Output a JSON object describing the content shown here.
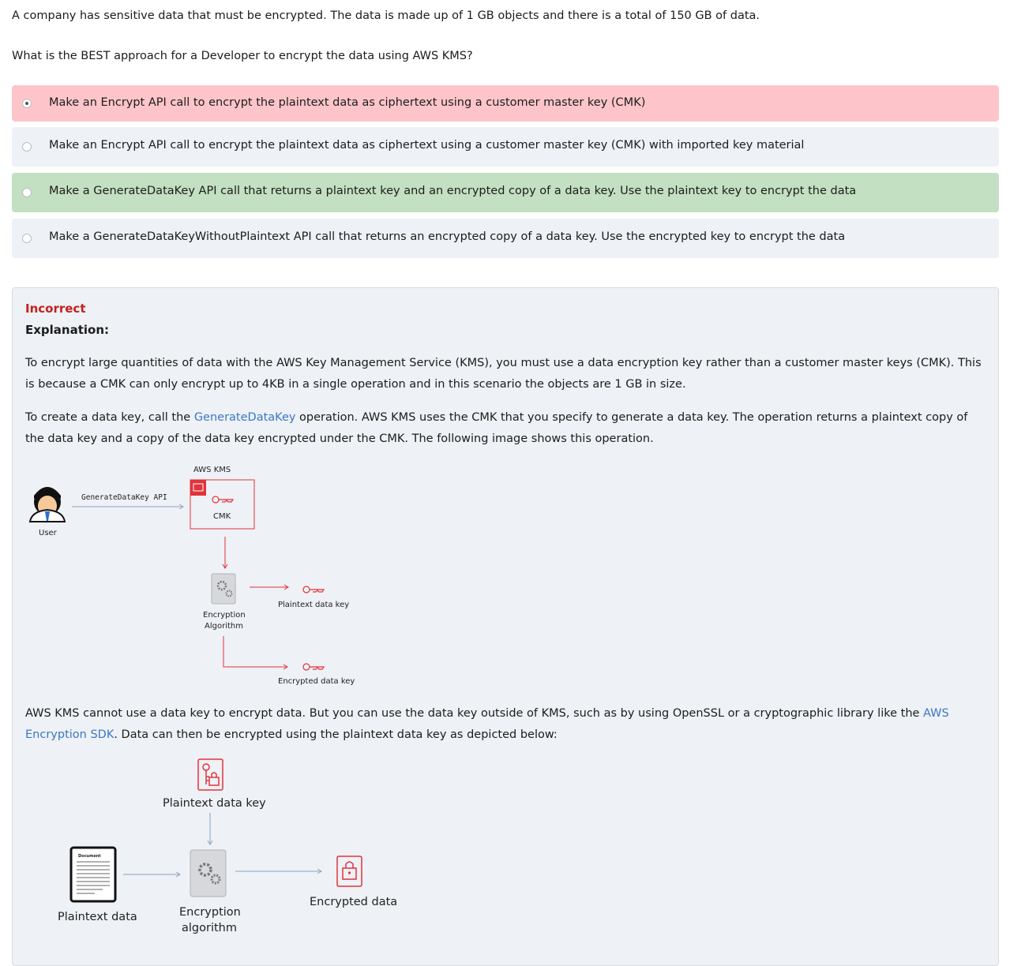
{
  "question": {
    "line1": "A company has sensitive data that must be encrypted. The data is made up of 1 GB objects and there is a total of 150 GB of data.",
    "line2": "What is the BEST approach for a Developer to encrypt the data using AWS KMS?"
  },
  "options": [
    {
      "label": "Make an Encrypt API call to encrypt the plaintext data as ciphertext using a customer master key (CMK)",
      "state": "selected-incorrect"
    },
    {
      "label": "Make an Encrypt API call to encrypt the plaintext data as ciphertext using a customer master key (CMK) with imported key material",
      "state": "none"
    },
    {
      "label": "Make a GenerateDataKey API call that returns a plaintext key and an encrypted copy of a data key. Use the plaintext key to encrypt the data",
      "state": "correct"
    },
    {
      "label": "Make a GenerateDataKeyWithoutPlaintext API call that returns an encrypted copy of a data key. Use the encrypted key to encrypt the data",
      "state": "none"
    }
  ],
  "explanation": {
    "status": "Incorrect",
    "heading": "Explanation:",
    "p1": "To encrypt large quantities of data with the AWS Key Management Service (KMS), you must use a data encryption key rather than a customer master keys (CMK). This is because a CMK can only encrypt up to 4KB in a single operation and in this scenario the objects are 1 GB in size.",
    "p2_before": "To create a data key, call the ",
    "p2_link": "GenerateDataKey",
    "p2_after": " operation. AWS KMS uses the CMK that you specify to generate a data key. The operation returns a plaintext copy of the data key and a copy of the data key encrypted under the CMK. The following image shows this operation.",
    "p3_before": "AWS KMS cannot use a data key to encrypt data. But you can use the data key outside of KMS, such as by using OpenSSL or a cryptographic library like the ",
    "p3_link": "AWS Encryption SDK",
    "p3_after": ". Data can then be encrypted using the plaintext data key as depicted below:"
  },
  "diagram1": {
    "user": "User",
    "api": "GenerateDataKey API",
    "kms": "AWS KMS",
    "cmk": "CMK",
    "algo1": "Encryption",
    "algo2": "Algorithm",
    "plain_key": "Plaintext data key",
    "enc_key": "Encrypted data key"
  },
  "diagram2": {
    "plain_key": "Plaintext data key",
    "doc_title": "Document",
    "plain_data": "Plaintext data",
    "algo1": "Encryption",
    "algo2": "algorithm",
    "enc_data": "Encrypted data"
  },
  "colors": {
    "incorrect": "#c3201e",
    "correct_bg": "#c3e0c2",
    "incorrect_bg": "#fdc5ca",
    "link": "#3a78c7",
    "kms_red": "#e0343c"
  }
}
